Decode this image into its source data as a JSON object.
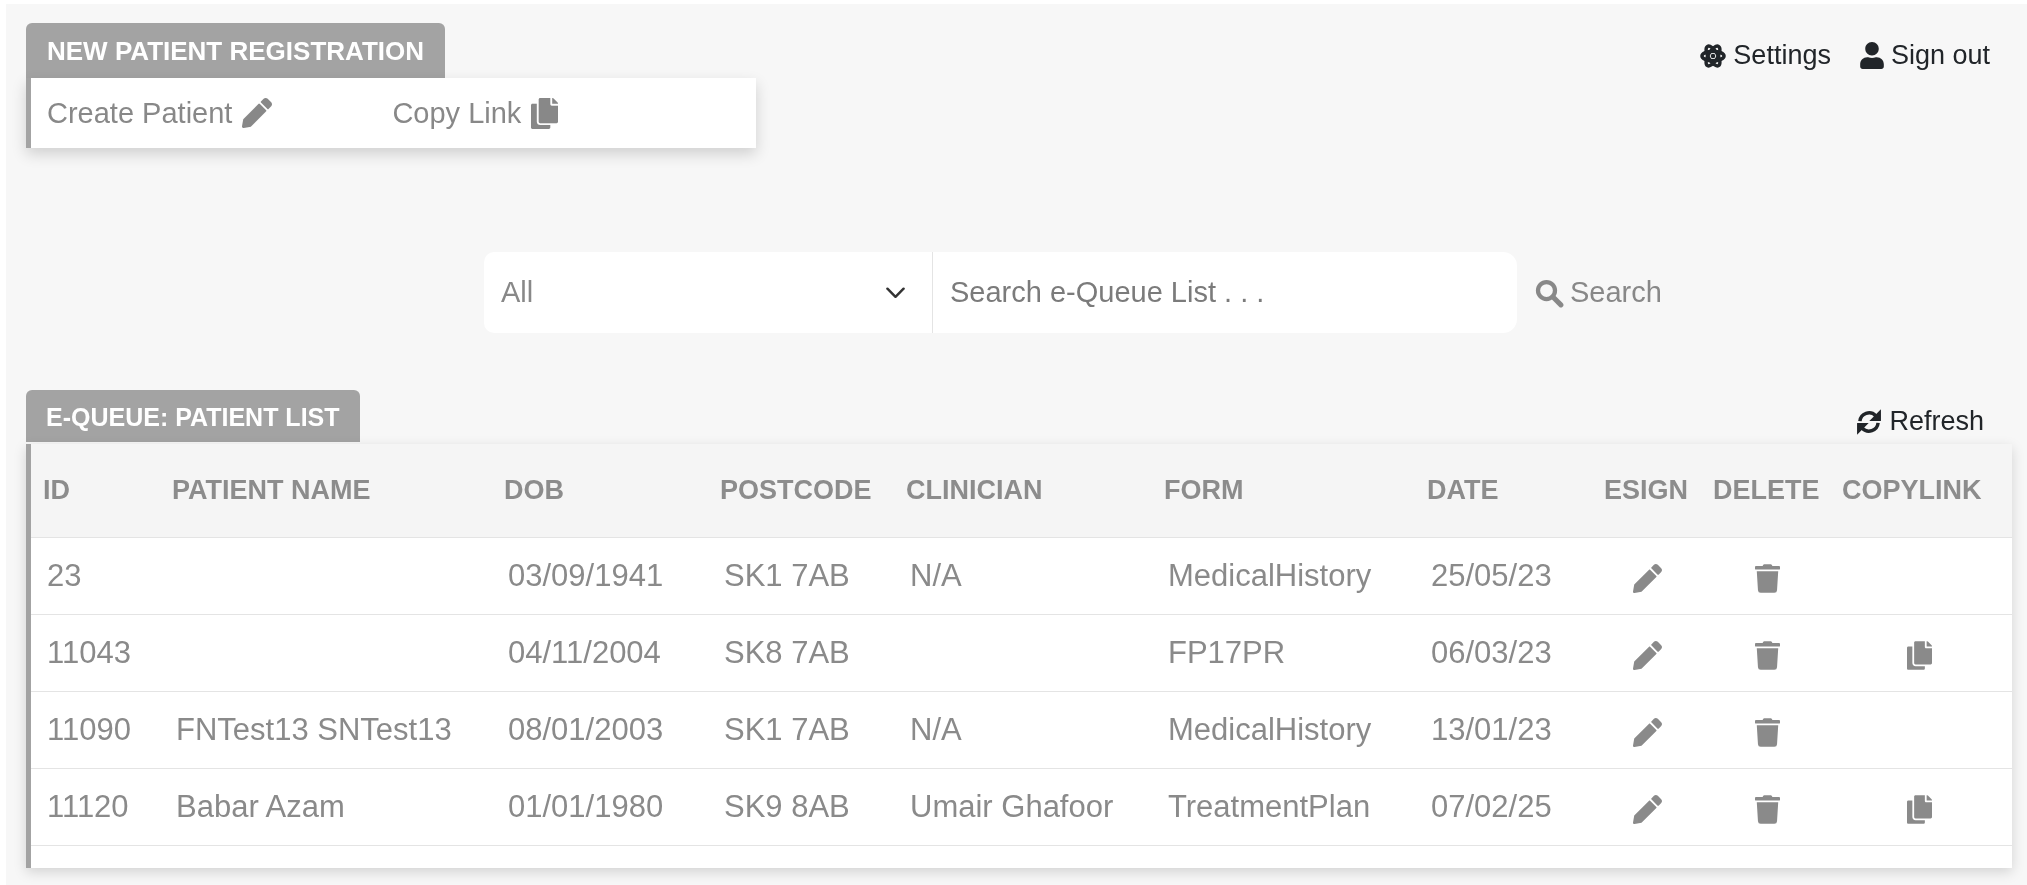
{
  "top_links": [
    {
      "kind": "settings",
      "label": "Settings"
    },
    {
      "kind": "account",
      "label": "Sign out"
    }
  ],
  "registration": {
    "title": "NEW PATIENT REGISTRATION",
    "actions": [
      {
        "kind": "create",
        "label": "Create Patient"
      },
      {
        "kind": "copy",
        "label": "Copy Link"
      }
    ]
  },
  "search": {
    "filter": "All",
    "placeholder": "Search e-Queue List . . .",
    "button": "Search"
  },
  "patient_list": {
    "title": "E-QUEUE: PATIENT LIST",
    "refresh": "Refresh",
    "columns": [
      {
        "kind": "text",
        "label": "ID"
      },
      {
        "kind": "text",
        "label": "PATIENT NAME"
      },
      {
        "kind": "text",
        "label": "DOB"
      },
      {
        "kind": "text",
        "label": "POSTCODE"
      },
      {
        "kind": "text",
        "label": "CLINICIAN"
      },
      {
        "kind": "text",
        "label": "FORM"
      },
      {
        "kind": "text",
        "label": "DATE"
      },
      {
        "kind": "action",
        "label": "ESIGN"
      },
      {
        "kind": "action",
        "label": "DELETE"
      },
      {
        "kind": "action",
        "label": "COPYLINK"
      }
    ],
    "rows": [
      {
        "id": "23",
        "dob": "03/09/1941",
        "postcode": "SK1 7AB",
        "clinician": "N/A",
        "form": "MedicalHistory",
        "date": "25/05/23",
        "esign": true,
        "delete": true,
        "copylink": false
      },
      {
        "id": "11043",
        "dob": "04/11/2004",
        "postcode": "SK8 7AB",
        "form": "FP17PR",
        "date": "06/03/23",
        "esign": true,
        "delete": true,
        "copylink": true
      },
      {
        "id": "11090",
        "patient_name": "FNTest13 SNTest13",
        "dob": "08/01/2003",
        "postcode": "SK1 7AB",
        "clinician": "N/A",
        "form": "MedicalHistory",
        "date": "13/01/23",
        "esign": true,
        "delete": true,
        "copylink": false
      },
      {
        "id": "11120",
        "patient_name": "Babar Azam",
        "dob": "01/01/1980",
        "postcode": "SK9 8AB",
        "clinician": "Umair Ghafoor",
        "form": "TreatmentPlan",
        "date": "07/02/25",
        "esign": true,
        "delete": true,
        "copylink": true
      }
    ]
  }
}
